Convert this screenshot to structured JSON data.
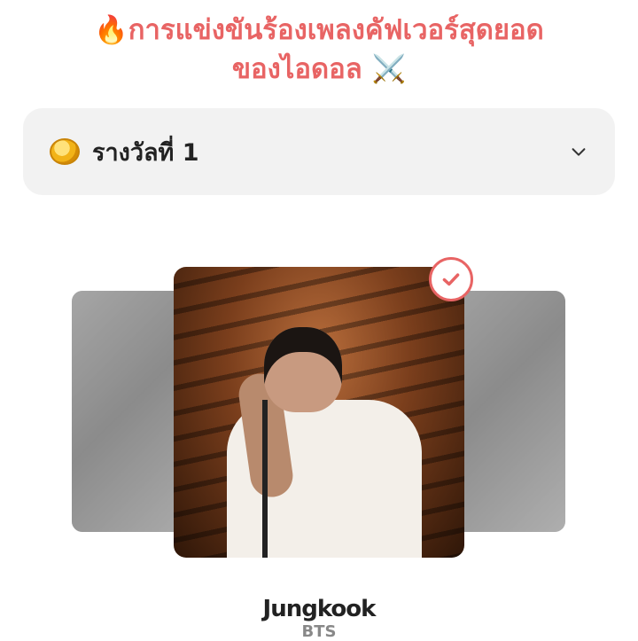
{
  "header": {
    "title_line1": "🔥การแข่งขันร้องเพลงคัฟเวอร์สุดยอด",
    "title_line2": "ของไอดอล ⚔️"
  },
  "award_dropdown": {
    "icon": "coin-icon",
    "label": "รางวัลที่ 1",
    "chevron": "chevron-down-icon"
  },
  "carousel": {
    "selected_index": 1,
    "selected_icon": "checkmark-icon",
    "accent_color": "#e86464"
  },
  "candidate": {
    "name": "Jungkook",
    "group": "BTS"
  }
}
